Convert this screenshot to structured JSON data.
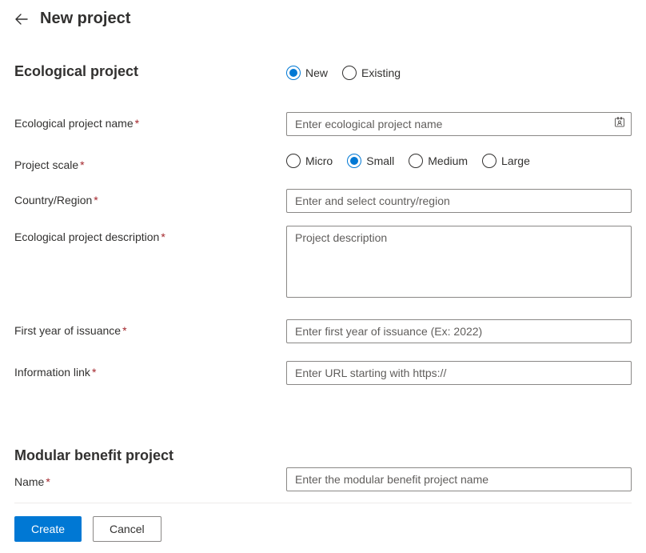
{
  "header": {
    "title": "New project"
  },
  "sections": {
    "ecological": {
      "title": "Ecological project",
      "fields": {
        "mode": {
          "options": [
            {
              "label": "New",
              "selected": true
            },
            {
              "label": "Existing",
              "selected": false
            }
          ]
        },
        "name": {
          "label": "Ecological project name",
          "placeholder": "Enter ecological project name"
        },
        "scale": {
          "label": "Project scale",
          "options": [
            {
              "label": "Micro",
              "selected": false
            },
            {
              "label": "Small",
              "selected": true
            },
            {
              "label": "Medium",
              "selected": false
            },
            {
              "label": "Large",
              "selected": false
            }
          ]
        },
        "country": {
          "label": "Country/Region",
          "placeholder": "Enter and select country/region"
        },
        "description": {
          "label": "Ecological project description",
          "placeholder": "Project description"
        },
        "firstYear": {
          "label": "First year of issuance",
          "placeholder": "Enter first year of issuance (Ex: 2022)"
        },
        "infoLink": {
          "label": "Information link",
          "placeholder": "Enter URL starting with https://"
        }
      }
    },
    "modular": {
      "title": "Modular benefit project",
      "fields": {
        "name": {
          "label": "Name",
          "placeholder": "Enter the modular benefit project name"
        }
      }
    }
  },
  "footer": {
    "create": "Create",
    "cancel": "Cancel"
  }
}
